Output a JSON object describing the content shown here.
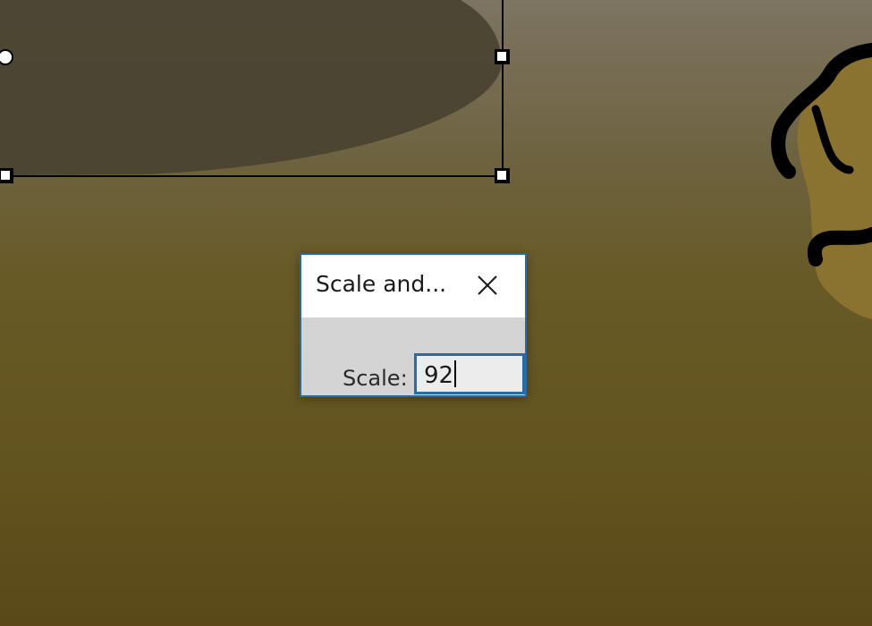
{
  "dialog": {
    "title": "Scale and...",
    "scale_label": "Scale:",
    "scale_value": "92",
    "close_icon": "close-icon"
  },
  "colors": {
    "dialog_border": "#2b6aa3",
    "dialog_body": "#d4d4d4",
    "canvas_top": "#7d7462",
    "canvas_bottom": "#5a4819",
    "ellipse_fill": "#4a4331",
    "brown_shape": "#8a7330"
  },
  "canvas": {
    "selection_handles": [
      "rotate-handle",
      "resize-handle-top-right",
      "resize-handle-bottom-left",
      "resize-handle-bottom-right"
    ]
  }
}
